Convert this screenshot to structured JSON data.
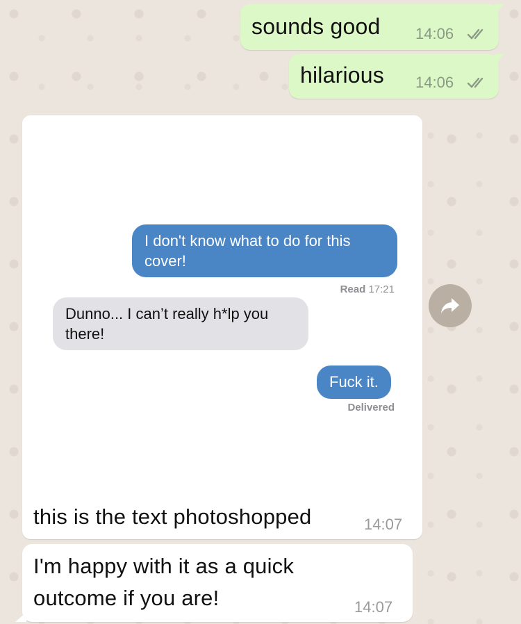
{
  "messages": {
    "m1": {
      "text": "sounds good",
      "time": "14:06"
    },
    "m2": {
      "text": "hilarious",
      "time": "14:06"
    },
    "image": {
      "caption": "this is the text photoshopped",
      "time": "14:07"
    },
    "m3": {
      "line1": "I'm happy with it as a quick",
      "line2": "outcome if you are!",
      "time": "14:07"
    }
  },
  "screenshot": {
    "blue1": {
      "line1": "I don't know what to do for this",
      "line2": "cover!"
    },
    "read_label": "Read",
    "read_time": "17:21",
    "gray1": {
      "line1": "Dunno... I can’t really h*lp you",
      "line2": "there!"
    },
    "blue2": "Fuck it.",
    "delivered": "Delivered"
  },
  "icons": {
    "forward": "forward-arrow-icon",
    "ticks": "double-check-icon"
  },
  "colors": {
    "sent_bubble": "#dcf8c6",
    "received_bubble": "#ffffff",
    "imessage_blue": "#4a86c5",
    "imessage_gray": "#e1e1e6",
    "chat_background": "#ece5dd"
  }
}
